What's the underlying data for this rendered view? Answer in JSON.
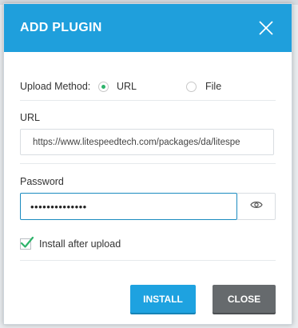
{
  "dialog": {
    "title": "ADD PLUGIN",
    "close_icon": "close-icon"
  },
  "upload_method": {
    "label": "Upload Method:",
    "options": [
      {
        "label": "URL",
        "selected": true
      },
      {
        "label": "File",
        "selected": false
      }
    ]
  },
  "url_field": {
    "label": "URL",
    "value": "https://www.litespeedtech.com/packages/da/litespe"
  },
  "password_field": {
    "label": "Password",
    "value": "••••••••••••••",
    "toggle_icon": "eye-icon"
  },
  "install_after_upload": {
    "label": "Install after upload",
    "checked": true
  },
  "buttons": {
    "install": "INSTALL",
    "close": "CLOSE"
  },
  "colors": {
    "header": "#1f9fdc",
    "install_button": "#1ea2e0",
    "close_button": "#666a6d",
    "accent_green": "#2db36a",
    "focus_border": "#1b8bbf"
  }
}
